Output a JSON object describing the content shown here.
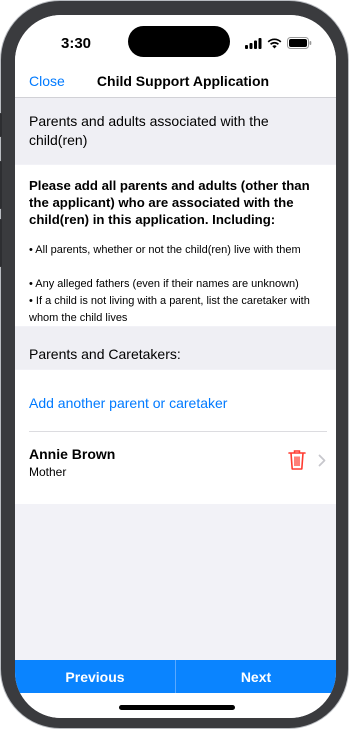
{
  "status_bar": {
    "time": "3:30"
  },
  "nav": {
    "close_label": "Close",
    "title": "Child Support Application"
  },
  "section_parents": {
    "title": "Parents and adults associated with the child(ren)"
  },
  "info": {
    "intro": "Please add all parents and adults (other than the applicant) who are associated with the child(ren) in this application. Including:",
    "bullets": [
      "• All parents, whether or not the child(ren) live with them",
      "• Any alleged fathers (even if their names are unknown)",
      "• If a child is not living with a parent, list the caretaker with whom the child lives"
    ]
  },
  "section_caretakers": {
    "title": "Parents and Caretakers:"
  },
  "list": {
    "add_label": "Add another parent or caretaker",
    "people": [
      {
        "name": "Annie Brown",
        "role": "Mother"
      }
    ]
  },
  "footer": {
    "previous_label": "Previous",
    "next_label": "Next"
  },
  "colors": {
    "accent": "#007aff",
    "bar": "#0a84ff",
    "delete": "#ff3b30"
  },
  "icons": {
    "status": [
      "signal-icon",
      "wifi-icon",
      "battery-icon"
    ],
    "row": [
      "trash-icon",
      "chevron-right-icon"
    ]
  }
}
